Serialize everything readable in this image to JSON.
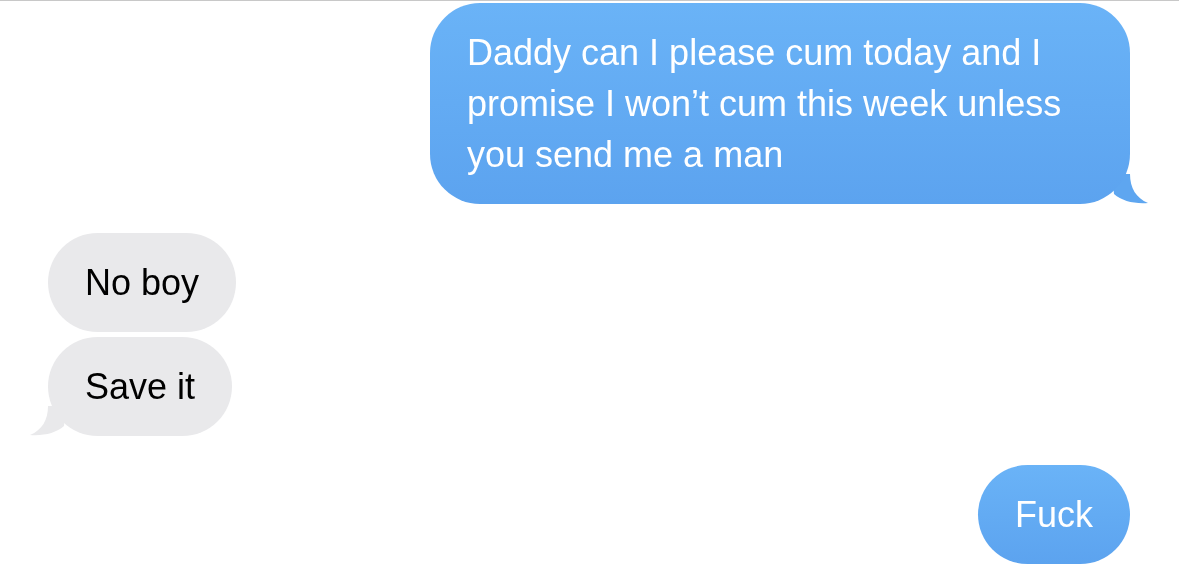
{
  "messages": [
    {
      "kind": "sent",
      "text": "Daddy can I please cum today and I promise I won’t cum this week unless you send me a man",
      "tail": true
    },
    {
      "kind": "received",
      "text": "No boy",
      "tail": false
    },
    {
      "kind": "received",
      "text": "Save it",
      "tail": true
    },
    {
      "kind": "sent",
      "text": "Fuck",
      "tail": false
    }
  ]
}
